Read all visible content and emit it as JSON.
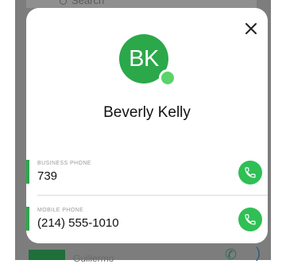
{
  "background": {
    "search_placeholder": "Search",
    "list_item_text": "Guillermo"
  },
  "contact": {
    "initials": "BK",
    "name": "Beverly Kelly",
    "phones": [
      {
        "label": "BUSINESS PHONE",
        "value": "739"
      },
      {
        "label": "MOBILE PHONE",
        "value": "(214) 555-1010"
      }
    ]
  },
  "icons": {
    "close": "close-icon",
    "call": "phone-icon",
    "search": "search-icon"
  },
  "colors": {
    "accent_green": "#2ba84a",
    "call_button_green": "#2fbf55",
    "presence_green": "#5ad36a",
    "backdrop_gray": "#7d7d7d"
  }
}
